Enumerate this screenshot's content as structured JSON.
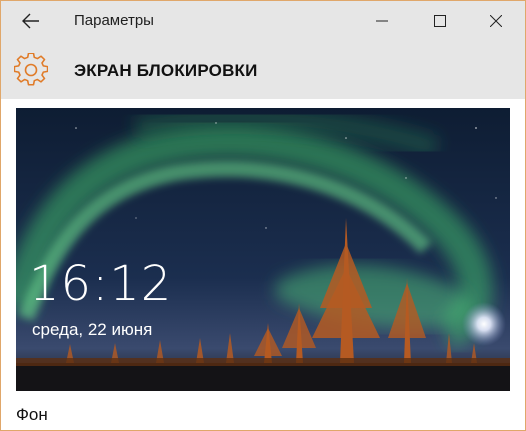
{
  "window": {
    "title": "Параметры",
    "back_icon": "arrow-left-icon",
    "minimize_icon": "minimize-icon",
    "maximize_icon": "maximize-icon",
    "close_icon": "close-icon"
  },
  "header": {
    "icon": "gear-icon",
    "accent_color": "#e07b28",
    "title": "ЭКРАН БЛОКИРОВКИ"
  },
  "preview": {
    "time": "16:12",
    "date": "среда, 22 июня"
  },
  "section": {
    "label": "Фон"
  }
}
